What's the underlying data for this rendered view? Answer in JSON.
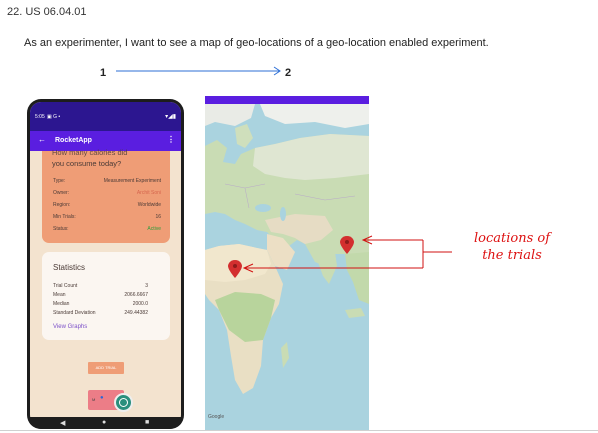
{
  "header": {
    "story_id": "22. US 06.04.01",
    "story_text": "As an experimenter, I want to see a map of geo-locations of a geo-location enabled experiment."
  },
  "steps": {
    "first": "1",
    "second": "2"
  },
  "phone": {
    "status_time": "5:05",
    "status_left_icons": "▣ G •",
    "status_right_icons": "▾◢▮",
    "app_title": "RocketApp",
    "back_icon": "←",
    "more_icon": "⋮",
    "experiment": {
      "question_line1": "How many calories did",
      "question_line2": "you consume today?",
      "fields": [
        {
          "label": "Type:",
          "value": "Measurement Experiment"
        },
        {
          "label": "Owner:",
          "value": "Archit Soni"
        },
        {
          "label": "Region:",
          "value": "Worldwide"
        },
        {
          "label": "Min Trials:",
          "value": "16"
        },
        {
          "label": "Status:",
          "value": "Active"
        }
      ],
      "status_color": "#2e9e3c",
      "owner_color": "#d6664e"
    },
    "statistics": {
      "title": "Statistics",
      "rows": [
        {
          "label": "Trial Count",
          "value": "3"
        },
        {
          "label": "Mean",
          "value": "2066.6667"
        },
        {
          "label": "Median",
          "value": "2000.0"
        },
        {
          "label": "Standard Deviation",
          "value": "249.44382"
        }
      ],
      "view_graphs": "View Graphs"
    },
    "add_trial_label": "ADD TRIAL",
    "map_button_label": "M",
    "nav": {
      "back": "◀",
      "home": "●",
      "recents": "■"
    }
  },
  "map": {
    "google_label": "Google",
    "pin_color": "#d32f2f"
  },
  "annotation": {
    "line1": "locations of",
    "line2": "the trials",
    "color": "#d11111"
  }
}
